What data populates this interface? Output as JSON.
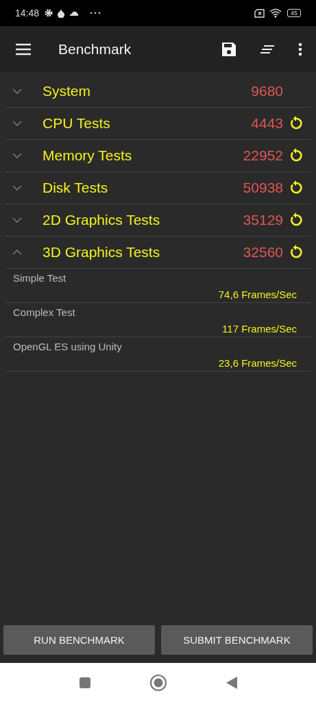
{
  "status_bar": {
    "time": "14:48",
    "battery": "45"
  },
  "toolbar": {
    "title": "Benchmark"
  },
  "sections": [
    {
      "name": "System",
      "score": "9680",
      "expanded": false,
      "refreshable": false
    },
    {
      "name": "CPU Tests",
      "score": "4443",
      "expanded": false,
      "refreshable": true
    },
    {
      "name": "Memory Tests",
      "score": "22952",
      "expanded": false,
      "refreshable": true
    },
    {
      "name": "Disk Tests",
      "score": "50938",
      "expanded": false,
      "refreshable": true
    },
    {
      "name": "2D Graphics Tests",
      "score": "35129",
      "expanded": false,
      "refreshable": true
    },
    {
      "name": "3D Graphics Tests",
      "score": "32560",
      "expanded": true,
      "refreshable": true,
      "results": [
        {
          "name": "Simple Test",
          "value": "74,6 Frames/Sec"
        },
        {
          "name": "Complex Test",
          "value": "117 Frames/Sec"
        },
        {
          "name": "OpenGL ES using Unity",
          "value": "23,6 Frames/Sec"
        }
      ]
    }
  ],
  "buttons": [
    "RUN BENCHMARK",
    "SUBMIT BENCHMARK"
  ]
}
